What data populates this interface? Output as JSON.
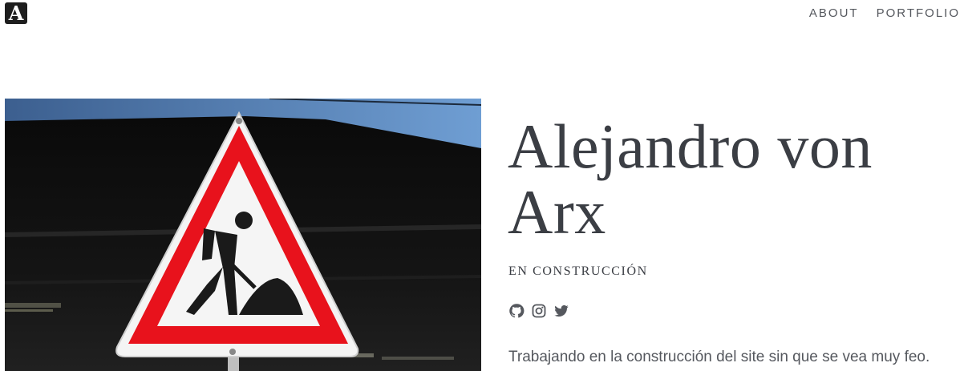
{
  "header": {
    "logo_letter": "A",
    "nav": [
      {
        "label": "ABOUT"
      },
      {
        "label": "PORTFOLIO"
      }
    ]
  },
  "hero": {
    "image_icon": "roadworks-sign-icon"
  },
  "profile": {
    "name": "Alejandro von Arx",
    "tagline": "EN CONSTRUCCIÓN",
    "social": [
      {
        "icon": "github-icon"
      },
      {
        "icon": "instagram-icon"
      },
      {
        "icon": "twitter-icon"
      }
    ],
    "intro": "Trabajando en la construcción del site sin que se vea muy feo."
  },
  "colors": {
    "text": "#3b3e44",
    "sign_red": "#e8121c",
    "logo_bg": "#1e1e1e"
  }
}
